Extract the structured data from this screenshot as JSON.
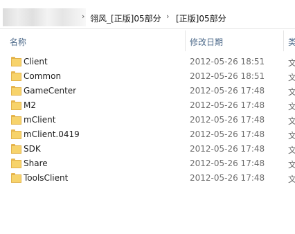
{
  "address_bar": {
    "crumbs": [
      "翎风_[正版]05部分",
      "[正版]05部分"
    ]
  },
  "columns": {
    "name": "名称",
    "modified": "修改日期",
    "type": "类"
  },
  "files": [
    {
      "name": "Client",
      "modified": "2012-05-26 18:51",
      "type": "文"
    },
    {
      "name": "Common",
      "modified": "2012-05-26 18:51",
      "type": "文"
    },
    {
      "name": "GameCenter",
      "modified": "2012-05-26 17:48",
      "type": "文"
    },
    {
      "name": "M2",
      "modified": "2012-05-26 17:48",
      "type": "文"
    },
    {
      "name": "mClient",
      "modified": "2012-05-26 17:48",
      "type": "文"
    },
    {
      "name": "mClient.0419",
      "modified": "2012-05-26 17:48",
      "type": "文"
    },
    {
      "name": "SDK",
      "modified": "2012-05-26 17:48",
      "type": "文"
    },
    {
      "name": "Share",
      "modified": "2012-05-26 17:48",
      "type": "文"
    },
    {
      "name": "ToolsClient",
      "modified": "2012-05-26 17:48",
      "type": "文"
    }
  ]
}
